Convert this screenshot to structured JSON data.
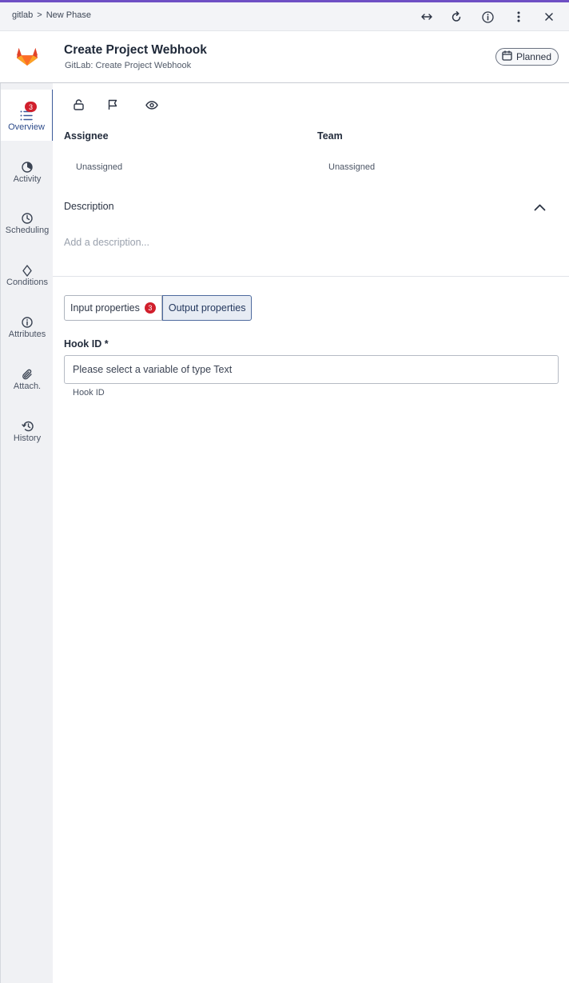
{
  "breadcrumb": {
    "root": "gitlab",
    "separator": ">",
    "current": "New Phase"
  },
  "titlebar_icons": [
    "expand-horizontal-icon",
    "refresh-icon",
    "info-icon",
    "more-vertical-icon",
    "close-icon"
  ],
  "header": {
    "title": "Create Project Webhook",
    "subtitle": "GitLab: Create Project Webhook",
    "status": "Planned",
    "logo": "gitlab-logo"
  },
  "sidebar": {
    "items": [
      {
        "label": "Overview",
        "icon": "list-icon",
        "badge": "3",
        "active": true
      },
      {
        "label": "Activity",
        "icon": "activity-icon"
      },
      {
        "label": "Scheduling",
        "icon": "clock-icon"
      },
      {
        "label": "Conditions",
        "icon": "diamond-icon"
      },
      {
        "label": "Attributes",
        "icon": "info-icon"
      },
      {
        "label": "Attach.",
        "icon": "paperclip-icon"
      },
      {
        "label": "History",
        "icon": "history-icon"
      }
    ]
  },
  "actions": [
    "unlock-icon",
    "flag-icon",
    "eye-icon"
  ],
  "assignee": {
    "label": "Assignee",
    "value": "Unassigned"
  },
  "team": {
    "label": "Team",
    "value": "Unassigned"
  },
  "description": {
    "title": "Description",
    "placeholder": "Add a description..."
  },
  "tabs": [
    {
      "label": "Input properties",
      "badge": "3",
      "selected": false
    },
    {
      "label": "Output properties",
      "selected": true
    }
  ],
  "hook": {
    "label": "Hook ID *",
    "placeholder": "Please select a variable of type Text",
    "help": "Hook ID"
  },
  "colors": {
    "accent": "#6e4fc4",
    "badge": "#d11f2c",
    "active_nav": "#3c5a9a"
  }
}
